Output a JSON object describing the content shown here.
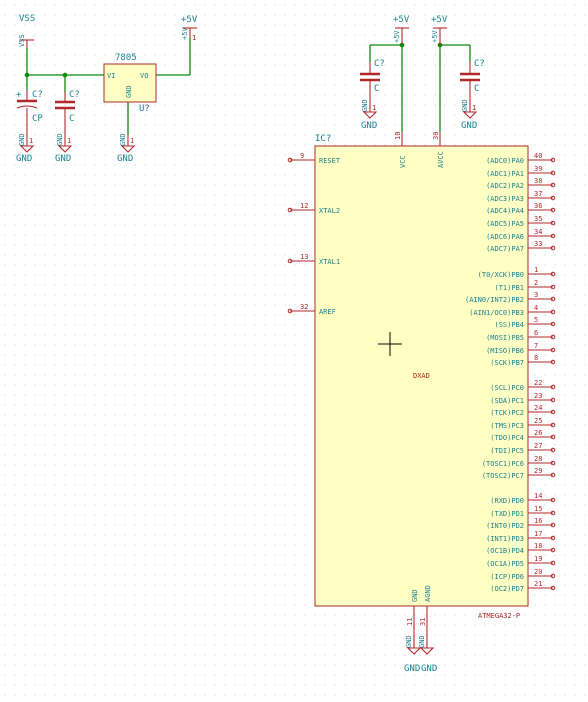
{
  "power": {
    "vss_label": "VSS",
    "vcc_5v_label": "+5V",
    "gnd_label": "GND",
    "pwr_pin_5v": "+5V",
    "pwr_pin_vss": "VSS"
  },
  "regulator": {
    "value": "7805",
    "ref": "U?",
    "pin_vi": "VI",
    "pin_vo": "VO",
    "pin_gnd": "GND"
  },
  "capacitors": {
    "c1": {
      "ref": "C?",
      "value": "CP"
    },
    "c2": {
      "ref": "C?",
      "value": "C"
    },
    "c3": {
      "ref": "C?",
      "value": "C"
    },
    "c4": {
      "ref": "C?",
      "value": "C"
    }
  },
  "mcu": {
    "ref": "IC?",
    "value": "ATMEGA32-P",
    "center_label": "DXAD",
    "left_pins": [
      {
        "num": "9",
        "name": "RESET"
      },
      {
        "num": "12",
        "name": "XTAL2"
      },
      {
        "num": "13",
        "name": "XTAL1"
      },
      {
        "num": "32",
        "name": "AREF"
      }
    ],
    "top_pins": [
      {
        "num": "10",
        "name": "VCC"
      },
      {
        "num": "30",
        "name": "AVCC"
      }
    ],
    "bottom_pins": [
      {
        "num": "11",
        "name": "GND"
      },
      {
        "num": "31",
        "name": "AGND"
      }
    ],
    "right_pins": [
      {
        "num": "40",
        "name": "(ADC0)PA0"
      },
      {
        "num": "39",
        "name": "(ADC1)PA1"
      },
      {
        "num": "38",
        "name": "(ADC2)PA2"
      },
      {
        "num": "37",
        "name": "(ADC3)PA3"
      },
      {
        "num": "36",
        "name": "(ADC4)PA4"
      },
      {
        "num": "35",
        "name": "(ADC5)PA5"
      },
      {
        "num": "34",
        "name": "(ADC6)PA6"
      },
      {
        "num": "33",
        "name": "(ADC7)PA7"
      },
      {
        "num": "1",
        "name": "(T0/XCK)PB0"
      },
      {
        "num": "2",
        "name": "(T1)PB1"
      },
      {
        "num": "3",
        "name": "(AIN0/INT2)PB2"
      },
      {
        "num": "4",
        "name": "(AIN1/OC0)PB3"
      },
      {
        "num": "5",
        "name": "(SS)PB4"
      },
      {
        "num": "6",
        "name": "(MOSI)PB5"
      },
      {
        "num": "7",
        "name": "(MISO)PB6"
      },
      {
        "num": "8",
        "name": "(SCK)PB7"
      },
      {
        "num": "22",
        "name": "(SCL)PC0"
      },
      {
        "num": "23",
        "name": "(SDA)PC1"
      },
      {
        "num": "24",
        "name": "(TCK)PC2"
      },
      {
        "num": "25",
        "name": "(TMS)PC3"
      },
      {
        "num": "26",
        "name": "(TDO)PC4"
      },
      {
        "num": "27",
        "name": "(TDI)PC5"
      },
      {
        "num": "28",
        "name": "(TOSC1)PC6"
      },
      {
        "num": "29",
        "name": "(TOSC2)PC7"
      },
      {
        "num": "14",
        "name": "(RXD)PD0"
      },
      {
        "num": "15",
        "name": "(TXD)PD1"
      },
      {
        "num": "16",
        "name": "(INT0)PD2"
      },
      {
        "num": "17",
        "name": "(INT1)PD3"
      },
      {
        "num": "18",
        "name": "(OC1B)PD4"
      },
      {
        "num": "19",
        "name": "(OC1A)PD5"
      },
      {
        "num": "20",
        "name": "(ICP)PD6"
      },
      {
        "num": "21",
        "name": "(OC2)PD7"
      }
    ]
  },
  "colors": {
    "wire": "#0c8a0c",
    "component": "#b0282a",
    "text": "#1a7f8f",
    "fill": "#ffffc4",
    "grid": "#c8c8c8"
  }
}
